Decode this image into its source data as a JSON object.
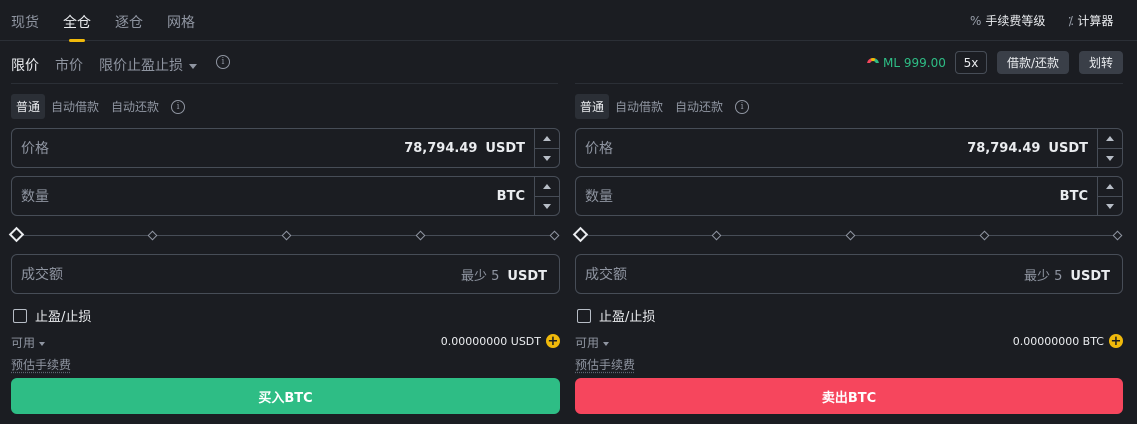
{
  "top_tabs": [
    "现货",
    "全仓",
    "逐仓",
    "网格"
  ],
  "top_right": {
    "fee_level": "手续费等级",
    "calculator": "计算器"
  },
  "order_types": {
    "limit": "限价",
    "market": "市价",
    "stop_limit": "限价止盈止损"
  },
  "margin_level": "ML 999.00",
  "leverage": "5x",
  "borrow_repay": "借款/还款",
  "transfer": "划转",
  "modes": [
    "普通",
    "自动借款",
    "自动还款"
  ],
  "buy_panel": {
    "price_label": "价格",
    "price_value": "78,794.49",
    "price_unit": "USDT",
    "amount_label": "数量",
    "amount_unit": "BTC",
    "total_label": "成交额",
    "total_min": "最少 5",
    "total_unit": "USDT",
    "tpsl_label": "止盈/止损",
    "available_label": "可用",
    "available_value": "0.00000000 USDT",
    "fee_label": "预估手续费",
    "action_label": "买入BTC"
  },
  "sell_panel": {
    "price_label": "价格",
    "price_value": "78,794.49",
    "price_unit": "USDT",
    "amount_label": "数量",
    "amount_unit": "BTC",
    "total_label": "成交额",
    "total_min": "最少 5",
    "total_unit": "USDT",
    "tpsl_label": "止盈/止损",
    "available_label": "可用",
    "available_value": "0.00000000 BTC",
    "fee_label": "预估手续费",
    "action_label": "卖出BTC"
  },
  "colors": {
    "buy": "#2ebd85",
    "sell": "#f6465d",
    "accent": "#f0b90b",
    "background": "#1b1d22"
  }
}
